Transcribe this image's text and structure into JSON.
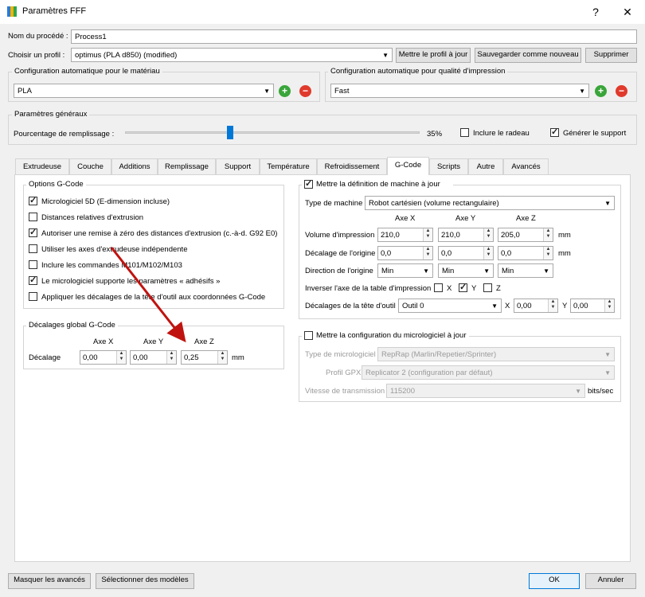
{
  "window": {
    "title": "Paramètres FFF",
    "help": "?",
    "close": "✕"
  },
  "process": {
    "label": "Nom du procédé :",
    "value": "Process1"
  },
  "profile": {
    "label": "Choisir un profil :",
    "value": "optimus (PLA d850) (modified)",
    "update_btn": "Mettre le profil à jour",
    "save_new_btn": "Sauvegarder comme nouveau",
    "delete_btn": "Supprimer"
  },
  "material": {
    "title": "Configuration automatique pour le matériau",
    "value": "PLA",
    "add": "+",
    "remove": "−"
  },
  "quality": {
    "title": "Configuration automatique pour qualité d'impression",
    "value": "Fast",
    "add": "+",
    "remove": "−"
  },
  "general": {
    "title": "Paramètres généraux",
    "infill_label": "Pourcentage de remplissage :",
    "infill_value": "35%",
    "raft_label": "Inclure le radeau",
    "support_label": "Générer le support"
  },
  "tabs": [
    "Extrudeuse",
    "Couche",
    "Additions",
    "Remplissage",
    "Support",
    "Température",
    "Refroidissement",
    "G-Code",
    "Scripts",
    "Autre",
    "Avancés"
  ],
  "gcode_options": {
    "title": "Options G-Code",
    "items": [
      {
        "label": "Micrologiciel 5D (E-dimension incluse)",
        "checked": true
      },
      {
        "label": "Distances relatives d'extrusion",
        "checked": false
      },
      {
        "label": "Autoriser une remise à zéro des distances d'extrusion (c.-à-d. G92 E0)",
        "checked": true
      },
      {
        "label": "Utiliser les axes d'extrudeuse indépendente",
        "checked": false
      },
      {
        "label": "Inclure les commandes M101/M102/M103",
        "checked": false
      },
      {
        "label": "Le micrologiciel supporte les paramètres « adhésifs »",
        "checked": true
      },
      {
        "label": "Appliquer les décalages de la tête d'outil aux coordonnées G-Code",
        "checked": false
      }
    ]
  },
  "global_offsets": {
    "title": "Décalages global G-Code",
    "axis_x": "Axe X",
    "axis_y": "Axe Y",
    "axis_z": "Axe Z",
    "label": "Décalage",
    "x": "0,00",
    "y": "0,00",
    "z": "0,25",
    "unit": "mm"
  },
  "machine": {
    "title": "Mettre la définition de machine à jour",
    "type_label": "Type de machine",
    "type_value": "Robot cartésien (volume rectangulaire)",
    "axis_x": "Axe X",
    "axis_y": "Axe Y",
    "axis_z": "Axe Z",
    "volume_label": "Volume d'impression",
    "volume": [
      "210,0",
      "210,0",
      "205,0"
    ],
    "origin_offset_label": "Décalage de l'origine",
    "origin_offset": [
      "0,0",
      "0,0",
      "0,0"
    ],
    "origin_dir_label": "Direction de l'origine",
    "origin_dir": [
      "Min",
      "Min",
      "Min"
    ],
    "unit": "mm",
    "invert_label": "Inverser l'axe de la table d'impression",
    "invert": {
      "x": "X",
      "y": "Y",
      "z": "Z"
    },
    "toolhead_label": "Décalages de la tête d'outil",
    "tool_value": "Outil 0",
    "tool_x_label": "X",
    "tool_x": "0,00",
    "tool_y_label": "Y",
    "tool_y": "0,00"
  },
  "firmware": {
    "title": "Mettre la configuration du micrologiciel à jour",
    "type_label": "Type de micrologiciel",
    "type_value": "RepRap (Marlin/Repetier/Sprinter)",
    "gpx_label": "Profil GPX",
    "gpx_value": "Replicator 2 (configuration par défaut)",
    "baud_label": "Vitesse de transmission",
    "baud_value": "115200",
    "baud_unit": "bits/sec"
  },
  "footer": {
    "hide_advanced": "Masquer les avancés",
    "select_models": "Sélectionner des modèles",
    "ok": "OK",
    "cancel": "Annuler"
  },
  "colors": {
    "accent": "#0078d7",
    "arrow": "#c0130f",
    "green": "#3aa53a",
    "red": "#e03a2c"
  }
}
